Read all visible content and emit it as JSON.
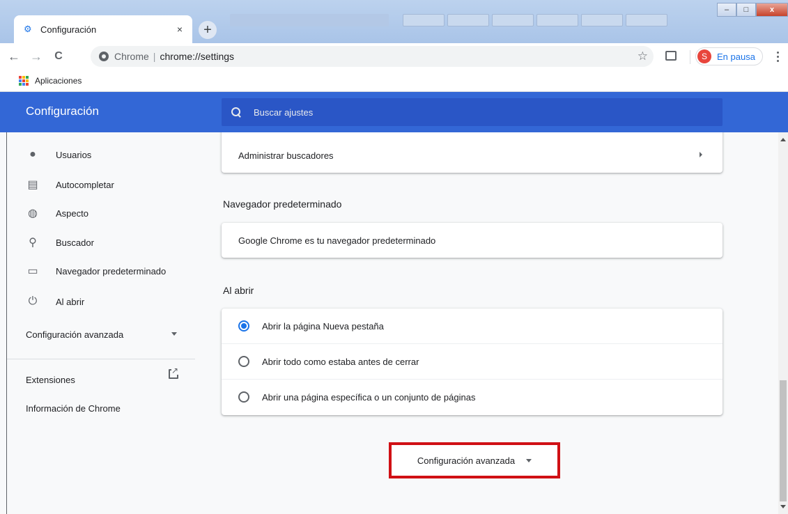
{
  "tab": {
    "title": "Configuración",
    "favicon": "gear-icon",
    "close_glyph": "×",
    "new_tab_glyph": "+"
  },
  "window": {
    "minimize_glyph": "–",
    "maximize_glyph": "□",
    "close_glyph": "x"
  },
  "toolbar": {
    "back_glyph": "←",
    "forward_glyph": "→",
    "reload_glyph": "C",
    "host": "Chrome",
    "separator": "|",
    "url": "chrome://settings",
    "star_glyph": "☆",
    "profile_initial": "S",
    "profile_status": "En pausa"
  },
  "bookmarks": {
    "apps_label": "Aplicaciones",
    "apps_colors": [
      "#ea4335",
      "#fbbc04",
      "#34a853",
      "#4285f4",
      "#ea4335",
      "#fbbc04",
      "#34a853",
      "#4285f4",
      "#ea4335"
    ]
  },
  "header": {
    "title": "Configuración",
    "search_placeholder": "Buscar ajustes"
  },
  "sidebar": {
    "items": [
      {
        "label": "Usuarios",
        "icon": "person-icon"
      },
      {
        "label": "Autocompletar",
        "icon": "clipboard-icon"
      },
      {
        "label": "Aspecto",
        "icon": "palette-icon"
      },
      {
        "label": "Buscador",
        "icon": "search-icon"
      },
      {
        "label": "Navegador predeterminado",
        "icon": "browser-icon"
      },
      {
        "label": "Al abrir",
        "icon": "power-icon"
      }
    ],
    "advanced_label": "Configuración avanzada",
    "extensions_label": "Extensiones",
    "about_label": "Información de Chrome"
  },
  "main": {
    "manage_search_engines": "Administrar buscadores",
    "default_browser_title": "Navegador predeterminado",
    "default_browser_status": "Google Chrome es tu navegador predeterminado",
    "on_startup_title": "Al abrir",
    "startup_options": [
      {
        "label": "Abrir la página Nueva pestaña",
        "selected": true
      },
      {
        "label": "Abrir todo como estaba antes de cerrar",
        "selected": false
      },
      {
        "label": "Abrir una página específica o un conjunto de páginas",
        "selected": false
      }
    ],
    "advanced_button_label": "Configuración avanzada"
  },
  "colors": {
    "header_blue": "#3367d6",
    "accent": "#1a73e8",
    "highlight_red": "#d01015"
  }
}
